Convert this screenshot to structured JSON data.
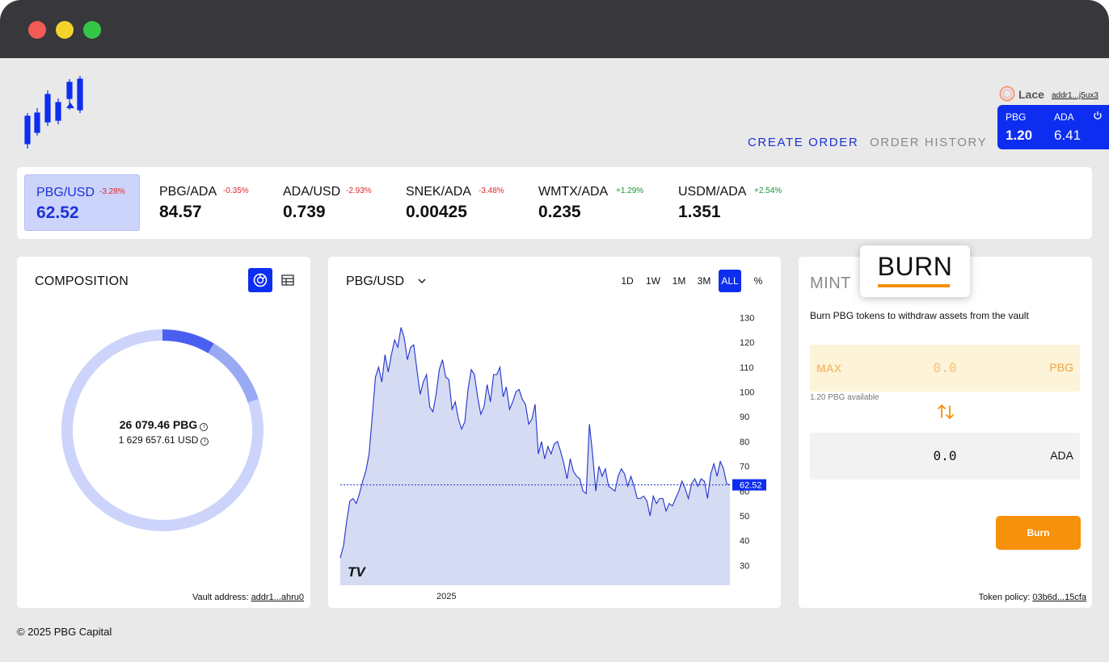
{
  "colors": {
    "accent": "#0d2df0",
    "burn": "#f7900a",
    "negative": "#e0242b",
    "positive": "#19913a",
    "chart_fill": "#d5dbf3",
    "chart_line": "#2233cc"
  },
  "nav": {
    "create_order": "CREATE ORDER",
    "order_history": "ORDER HISTORY"
  },
  "wallet": {
    "name": "Lace",
    "address": "addr1...j5ux3",
    "balances": [
      {
        "token": "PBG",
        "amount": "1.20"
      },
      {
        "token": "ADA",
        "amount": "6.41"
      }
    ]
  },
  "tickers": [
    {
      "pair": "PBG/USD",
      "change": "-3.28%",
      "price": "62.52",
      "direction": "down",
      "active": true
    },
    {
      "pair": "PBG/ADA",
      "change": "-0.35%",
      "price": "84.57",
      "direction": "down"
    },
    {
      "pair": "ADA/USD",
      "change": "-2.93%",
      "price": "0.739",
      "direction": "down"
    },
    {
      "pair": "SNEK/ADA",
      "change": "-3.48%",
      "price": "0.00425",
      "direction": "down"
    },
    {
      "pair": "WMTX/ADA",
      "change": "+1.29%",
      "price": "0.235",
      "direction": "up"
    },
    {
      "pair": "USDM/ADA",
      "change": "+2.54%",
      "price": "1.351",
      "direction": "up"
    }
  ],
  "composition": {
    "title": "COMPOSITION",
    "total_pbg": "26 079.46 PBG",
    "total_usd": "1 629 657.61 USD",
    "info_glyph": "i",
    "vault_label": "Vault address:",
    "vault_address": "addr1...ahru0",
    "segments": [
      {
        "share": 0.085,
        "color": "#4a5ff0"
      },
      {
        "share": 0.115,
        "color": "#9aa9f3"
      },
      {
        "share": 0.8,
        "color": "#ccd4fb"
      }
    ]
  },
  "chart": {
    "pair": "PBG/USD",
    "timeframes": [
      "1D",
      "1W",
      "1M",
      "3M",
      "ALL",
      "%"
    ],
    "active_timeframe": "ALL",
    "watermark": "TV"
  },
  "chart_data": {
    "type": "area",
    "x_label_ticks": [
      "2025"
    ],
    "y_ticks": [
      30,
      40,
      50,
      60,
      70,
      80,
      90,
      100,
      110,
      120,
      130
    ],
    "ylim": [
      22,
      135
    ],
    "last_price": 62.52,
    "values": [
      33,
      38,
      48,
      56,
      57,
      55,
      59,
      64,
      68,
      75,
      90,
      106,
      110,
      104,
      115,
      108,
      115,
      121,
      118,
      126,
      122,
      113,
      118,
      119,
      109,
      99,
      104,
      107,
      94,
      92,
      99,
      109,
      113,
      106,
      105,
      93,
      96,
      89,
      85,
      88,
      101,
      109,
      107,
      98,
      91,
      94,
      103,
      96,
      107,
      107,
      110,
      98,
      102,
      93,
      96,
      100,
      101,
      97,
      95,
      87,
      89,
      95,
      75,
      80,
      73,
      78,
      75,
      79,
      80,
      76,
      71,
      65,
      73,
      68,
      66,
      65,
      60,
      59,
      87,
      75,
      60,
      70,
      66,
      69,
      62,
      61,
      60,
      66,
      69,
      67,
      62,
      66,
      62,
      57,
      57,
      58,
      56,
      50,
      58,
      55,
      57,
      57,
      52,
      55,
      54,
      57,
      60,
      64,
      61,
      57,
      63,
      65,
      62,
      65,
      64,
      57,
      67,
      71,
      66,
      72,
      69,
      63,
      62.5
    ],
    "grid": false,
    "dotted_price_line": true
  },
  "burn_panel": {
    "tab_mint": "MINT",
    "tab_burn": "BURN",
    "description": "Burn PBG tokens to withdraw assets from the vault",
    "input": {
      "max_label": "MAX",
      "value": "0.0",
      "unit": "PBG",
      "available": "1.20 PBG available"
    },
    "output": {
      "value": "0.0",
      "unit": "ADA"
    },
    "button": "Burn",
    "policy_label": "Token policy:",
    "policy_id": "03b6d...15cfa"
  },
  "footer": {
    "copyright": "© 2025 PBG Capital"
  }
}
